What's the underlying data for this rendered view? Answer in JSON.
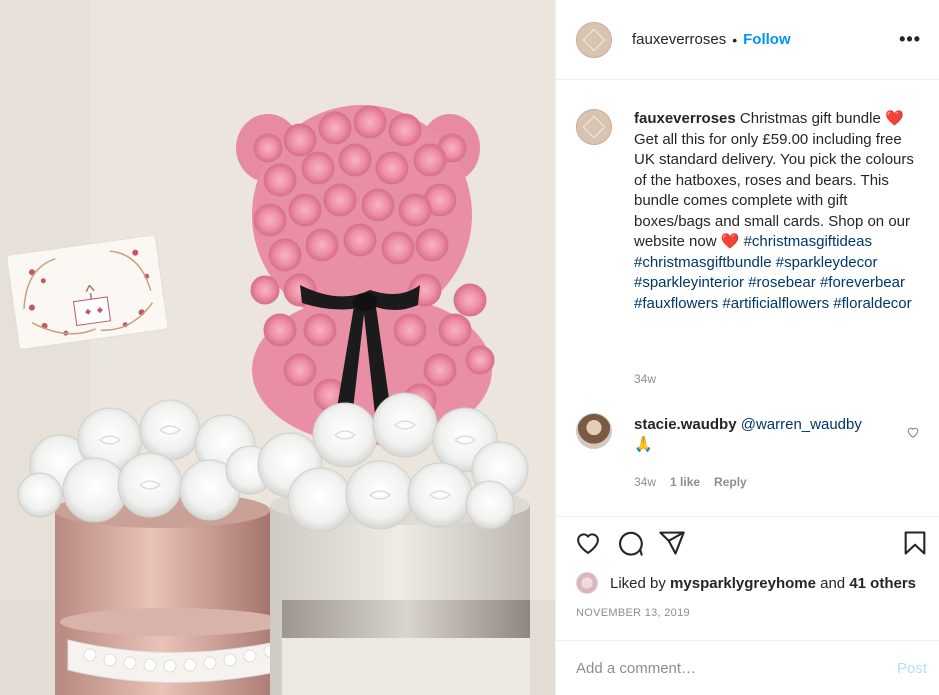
{
  "photo": {
    "alt": "Pink rose bear with white rose hatboxes"
  },
  "header": {
    "username": "fauxeverroses",
    "separator": "•",
    "follow_label": "Follow",
    "more_label": "•••"
  },
  "caption": {
    "username": "fauxeverroses",
    "text_1": "Christmas gift bundle",
    "emoji_1": "❤️",
    "text_2": "Get all this for only £59.00 including free UK standard delivery. You pick the colours of the hatboxes, roses and bears. This bundle comes complete with gift boxes/bags and small cards. Shop on our website now",
    "emoji_2": "❤️",
    "hashtags": [
      "#christmasgiftideas",
      "#christmasgiftbundle",
      "#sparkleydecor",
      "#sparkleyinterior",
      "#rosebear",
      "#foreverbear",
      "#fauxflowers",
      "#artificialflowers",
      "#floraldecor"
    ],
    "age": "34w"
  },
  "comment": {
    "username": "stacie.waudby",
    "mention": "@warren_waudby",
    "emoji": "🙏",
    "age": "34w",
    "likes": "1 like",
    "reply_label": "Reply"
  },
  "likes": {
    "prefix": "Liked by",
    "user": "mysparklygreyhome",
    "and": "and",
    "others": "41 others"
  },
  "date": "NOVEMBER 13, 2019",
  "add_comment": {
    "placeholder": "Add a comment…",
    "post_label": "Post"
  },
  "icons": [
    "heart-icon",
    "comment-icon",
    "share-icon",
    "bookmark-icon"
  ],
  "colors": {
    "link": "#0095f6",
    "hashtag": "#00376b",
    "muted": "#8e8e8e",
    "post_disabled": "#b2dffc"
  }
}
